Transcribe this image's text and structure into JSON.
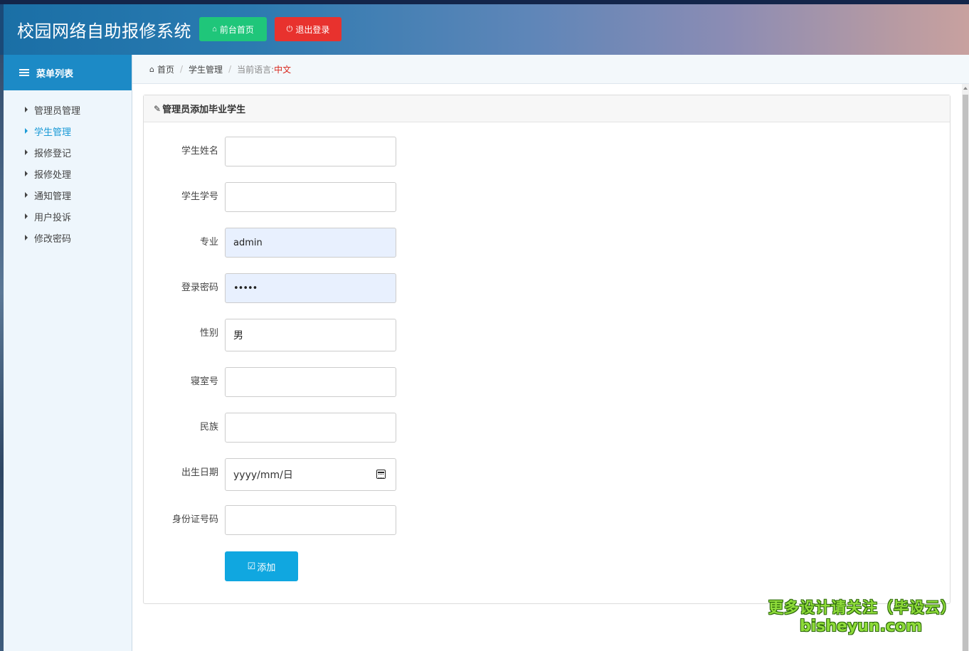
{
  "header": {
    "title": "校园网络自助报修系统",
    "home_button": "前台首页",
    "logout_button": "退出登录",
    "colors": {
      "home_button": "#1fc67a",
      "logout_button": "#e8322e"
    }
  },
  "sidebar": {
    "title": "菜单列表",
    "items": [
      {
        "label": "管理员管理"
      },
      {
        "label": "学生管理"
      },
      {
        "label": "报修登记"
      },
      {
        "label": "报修处理"
      },
      {
        "label": "通知管理"
      },
      {
        "label": "用户投诉"
      },
      {
        "label": "修改密码"
      }
    ],
    "active_index": 1
  },
  "breadcrumb": {
    "home": "首页",
    "section": "学生管理",
    "lang_label": "当前语言:",
    "lang_value": "中文"
  },
  "form": {
    "title": "管理员添加毕业学生",
    "fields": [
      {
        "label": "学生姓名",
        "value": ""
      },
      {
        "label": "学生学号",
        "value": ""
      },
      {
        "label": "专业",
        "value": "admin"
      },
      {
        "label": "登录密码",
        "value": "•••••"
      },
      {
        "label": "性别",
        "value": "男"
      },
      {
        "label": "寝室号",
        "value": ""
      },
      {
        "label": "民族",
        "value": ""
      },
      {
        "label": "出生日期",
        "value": "yyyy/mm/日"
      },
      {
        "label": "身份证号码",
        "value": ""
      }
    ],
    "submit": "添加",
    "submit_color": "#10a7e0"
  },
  "watermark": {
    "line1": "更多设计请关注（毕设云）",
    "line2": "bisheyun.com"
  }
}
